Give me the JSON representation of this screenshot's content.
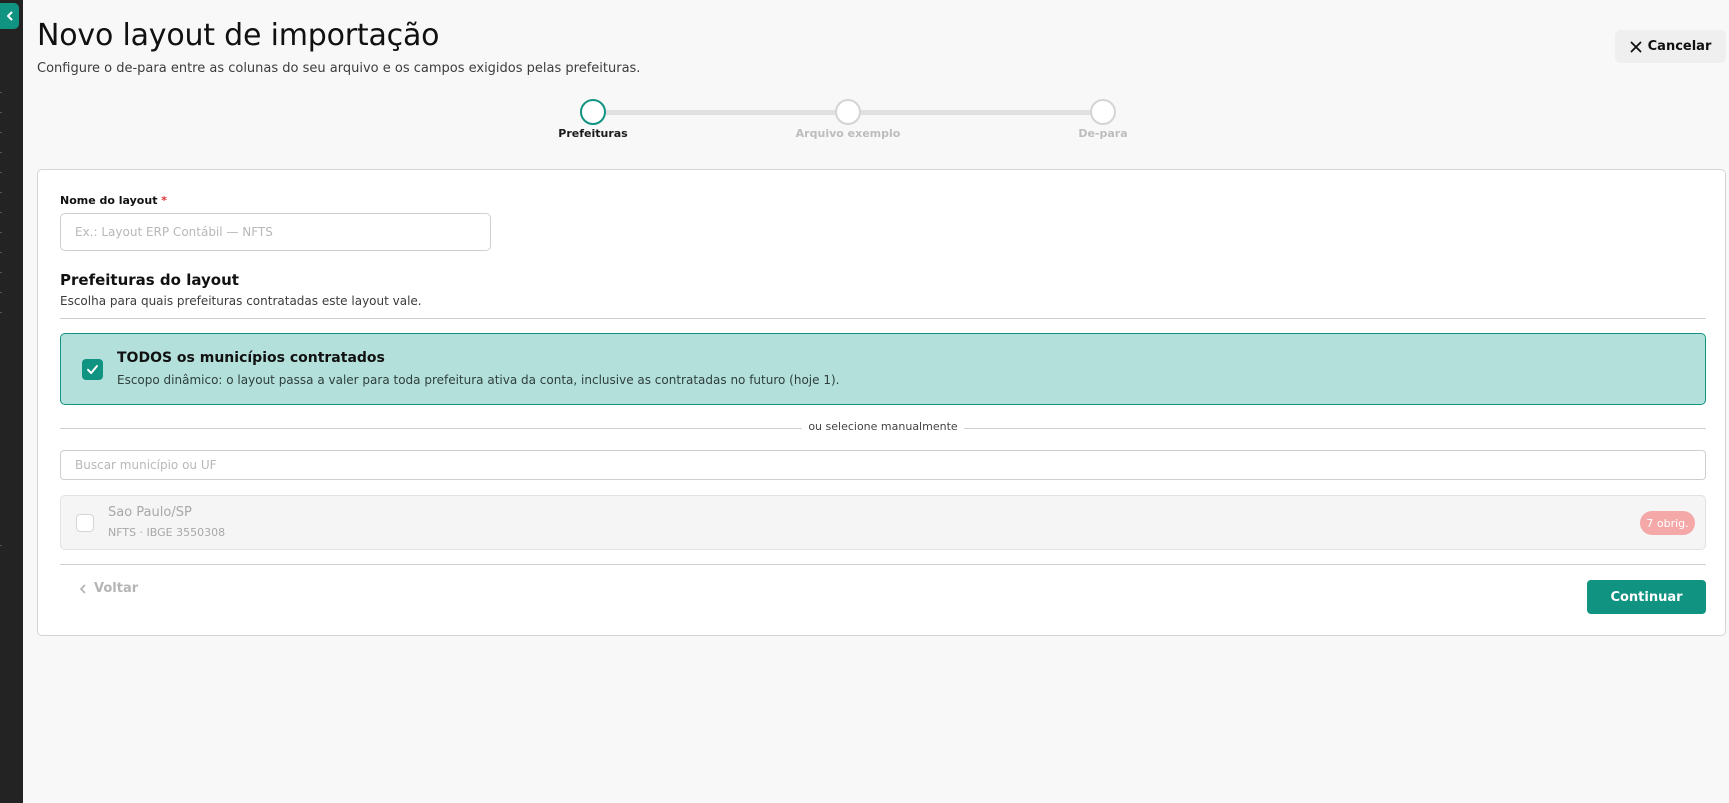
{
  "page": {
    "title": "Novo layout de importação",
    "subtitle": "Configure o de-para entre as colunas do seu arquivo e os campos exigidos pelas prefeituras."
  },
  "actions": {
    "cancel_label": "Cancelar",
    "back_label": "Voltar",
    "continue_label": "Continuar"
  },
  "stepper": {
    "active_step": 1,
    "steps": [
      {
        "label": "Prefeituras"
      },
      {
        "label": "Arquivo exemplo"
      },
      {
        "label": "De-para"
      }
    ]
  },
  "form": {
    "layout_name": {
      "label": "Nome do layout",
      "required_marker": "*",
      "value": "",
      "placeholder": "Ex.: Layout ERP Contábil — NFTS"
    },
    "prefeituras": {
      "title": "Prefeituras do layout",
      "description": "Escolha para quais prefeituras contratadas este layout vale.",
      "all_option": {
        "checked": true,
        "title": "TODOS os municípios contratados",
        "description": "Escopo dinâmico: o layout passa a valer para toda prefeitura ativa da conta, inclusive as contratadas no futuro (hoje 1)."
      },
      "manual_divider": "ou selecione manualmente",
      "search_placeholder": "Buscar município ou UF",
      "municipalities": [
        {
          "name": "Sao Paulo/SP",
          "meta": "NFTS · IBGE 3550308",
          "badge": "7 obrig.",
          "checked": false
        }
      ]
    }
  },
  "colors": {
    "accent": "#119382",
    "accent_light": "#b4e0db",
    "badge": "#f4a8a8",
    "sidebar": "#232323"
  },
  "icons": {
    "sidebar_toggle": "chevron-left-icon",
    "cancel": "close-icon",
    "back": "chevron-left-icon",
    "all_option": "checkmark-icon"
  }
}
